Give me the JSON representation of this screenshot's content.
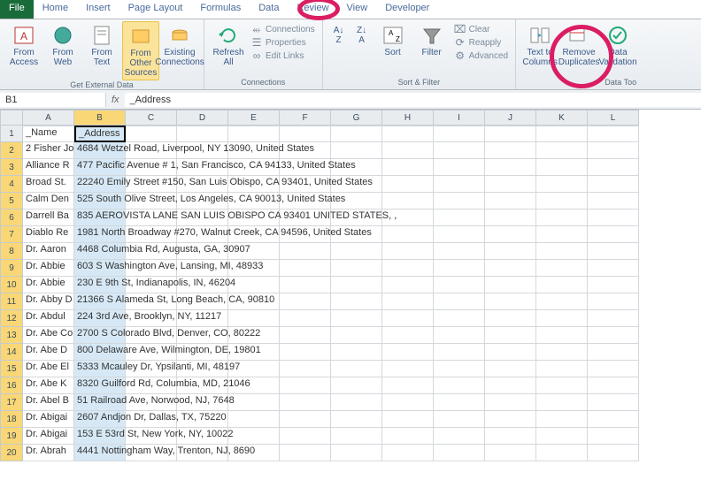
{
  "tabs": [
    "File",
    "Home",
    "Insert",
    "Page Layout",
    "Formulas",
    "Data",
    "Review",
    "View",
    "Developer"
  ],
  "active_tab": "Data",
  "ribbon": {
    "groups": [
      {
        "label": "Get External Data",
        "items": [
          "From Access",
          "From Web",
          "From Text",
          "From Other Sources",
          "Existing Connections"
        ]
      },
      {
        "label": "Connections",
        "items": [
          "Refresh All"
        ],
        "small": [
          "Connections",
          "Properties",
          "Edit Links"
        ]
      },
      {
        "label": "Sort & Filter",
        "items": [
          "Sort",
          "Filter"
        ],
        "small": [
          "Clear",
          "Reapply",
          "Advanced"
        ]
      },
      {
        "label": "Data Too",
        "items": [
          "Text to Columns",
          "Remove Duplicates",
          "Data Validation"
        ]
      }
    ]
  },
  "namebox": "B1",
  "formula": "_Address",
  "cols": [
    "A",
    "B",
    "C",
    "D",
    "E",
    "F",
    "G",
    "H",
    "I",
    "J",
    "K",
    "L"
  ],
  "headers": {
    "A": "_Name",
    "B": "_Address"
  },
  "rows": [
    {
      "n": "2 Fisher Jo",
      "a": "4684 Wetzel Road, Liverpool, NY 13090, United States"
    },
    {
      "n": "Alliance R",
      "a": "477 Pacific Avenue # 1, San Francisco, CA 94133, United States"
    },
    {
      "n": "Broad St. ",
      "a": "22240 Emily Street #150, San Luis Obispo, CA 93401, United States"
    },
    {
      "n": "Calm Den",
      "a": "525 South Olive Street, Los Angeles, CA 90013, United States"
    },
    {
      "n": "Darrell Ba",
      "a": "835 AEROVISTA LANE  SAN LUIS OBISPO  CA 93401  UNITED STATES, ,"
    },
    {
      "n": "Diablo Re",
      "a": "1981 North Broadway #270, Walnut Creek, CA 94596, United States"
    },
    {
      "n": "Dr. Aaron",
      "a": "4468 Columbia Rd, Augusta, GA, 30907"
    },
    {
      "n": "Dr. Abbie",
      "a": "603 S Washington Ave, Lansing, MI, 48933"
    },
    {
      "n": "Dr. Abbie",
      "a": "230 E 9th St, Indianapolis, IN, 46204"
    },
    {
      "n": "Dr. Abby D",
      "a": "21366 S Alameda St, Long Beach, CA, 90810"
    },
    {
      "n": "Dr. Abdul",
      "a": "224 3rd Ave, Brooklyn, NY, 11217"
    },
    {
      "n": "Dr. Abe Co",
      "a": "2700 S Colorado Blvd, Denver, CO, 80222"
    },
    {
      "n": "Dr. Abe D",
      "a": "800 Delaware Ave, Wilmington, DE, 19801"
    },
    {
      "n": "Dr. Abe El",
      "a": "5333 Mcauley Dr, Ypsilanti, MI, 48197"
    },
    {
      "n": "Dr. Abe K",
      "a": "8320 Guilford Rd, Columbia, MD, 21046"
    },
    {
      "n": "Dr. Abel B",
      "a": "51 Railroad Ave, Norwood, NJ, 7648"
    },
    {
      "n": "Dr. Abigai",
      "a": "2607 Andjon Dr, Dallas, TX, 75220"
    },
    {
      "n": "Dr. Abigai",
      "a": "153 E 53rd St, New York, NY, 10022"
    },
    {
      "n": "Dr. Abrah",
      "a": "4441 Nottingham Way, Trenton, NJ, 8690"
    }
  ]
}
